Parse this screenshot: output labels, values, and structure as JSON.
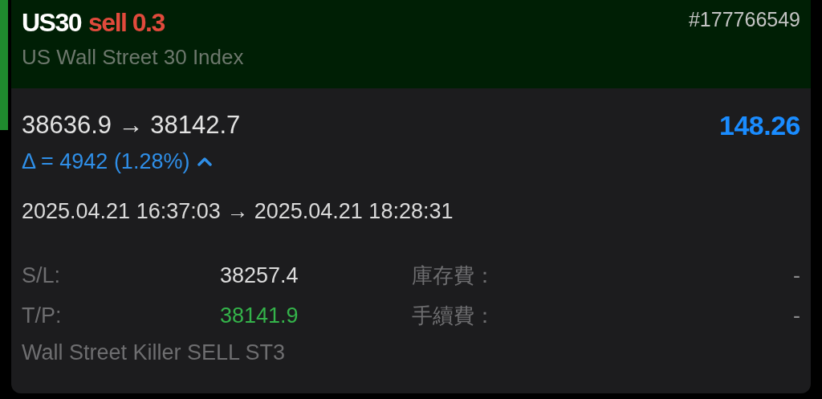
{
  "trade": {
    "symbol": "US30",
    "order_type": {
      "kind": "sell",
      "label": "sell"
    },
    "volume": "0.3",
    "ticket": "#177766549",
    "description": "US Wall Street 30 Index"
  },
  "prices": {
    "open_price": "38636.9",
    "arrow": "→",
    "close_price": "38142.7",
    "profit": "148.26",
    "delta": "Δ = 4942 (1.28%)"
  },
  "times": {
    "open_time": "2025.04.21 16:37:03",
    "arrow": "→",
    "close_time": "2025.04.21 18:28:31"
  },
  "details": [
    {
      "kind": "stop_loss",
      "label": "S/L:",
      "value": "38257.4",
      "fee_label": "庫存費：",
      "fee_value": "-"
    },
    {
      "kind": "take_profit",
      "label": "T/P:",
      "value": "38141.9",
      "fee_label": "手續費：",
      "fee_value": "-"
    }
  ],
  "comment": "Wall Street Killer SELL ST3"
}
